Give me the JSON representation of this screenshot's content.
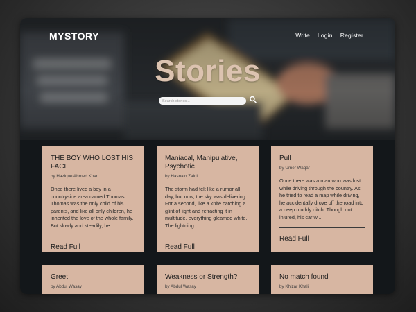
{
  "brand": {
    "name": "MYSTORY"
  },
  "nav": {
    "items": [
      "Write",
      "Login",
      "Register"
    ]
  },
  "hero": {
    "title": "Stories",
    "search_placeholder": "Search stories...",
    "search_icon": "search-icon"
  },
  "stories": [
    {
      "title": "THE BOY WHO LOST HIS FACE",
      "author": "by Hazique Ahmed Khan",
      "excerpt": "Once there lived a boy in a countryside area named Thomas. Thomas was the only child of his parents, and like all only children, he inherited the love of the whole family. But slowly and steadily, he...",
      "cta": "Read Full"
    },
    {
      "title": "Maniacal, Manipulative, Psychotic",
      "author": "by Hasnain Zaidi",
      "excerpt": "The storm had felt like a rumor all day, but now, the sky was delivering. For a second, like a knife catching a glint of light and refracting it in multitude, everything gleamed white. The lightning ...",
      "cta": "Read Full"
    },
    {
      "title": "Pull",
      "author": "by Umer Waqar",
      "excerpt": "Once there was a man who was lost while driving through the country. As he tried to read a map while driving, he accidentally drove off the road into a deep muddy ditch. Though not injured, his car w...",
      "cta": "Read Full"
    },
    {
      "title": "Greet",
      "author": "by Abdul Wasay",
      "excerpt": "",
      "cta": ""
    },
    {
      "title": "Weakness or Strength?",
      "author": "by Abdul Wasay",
      "excerpt": "",
      "cta": ""
    },
    {
      "title": "No match found",
      "author": "by Khizar Khalil",
      "excerpt": "",
      "cta": ""
    }
  ]
}
